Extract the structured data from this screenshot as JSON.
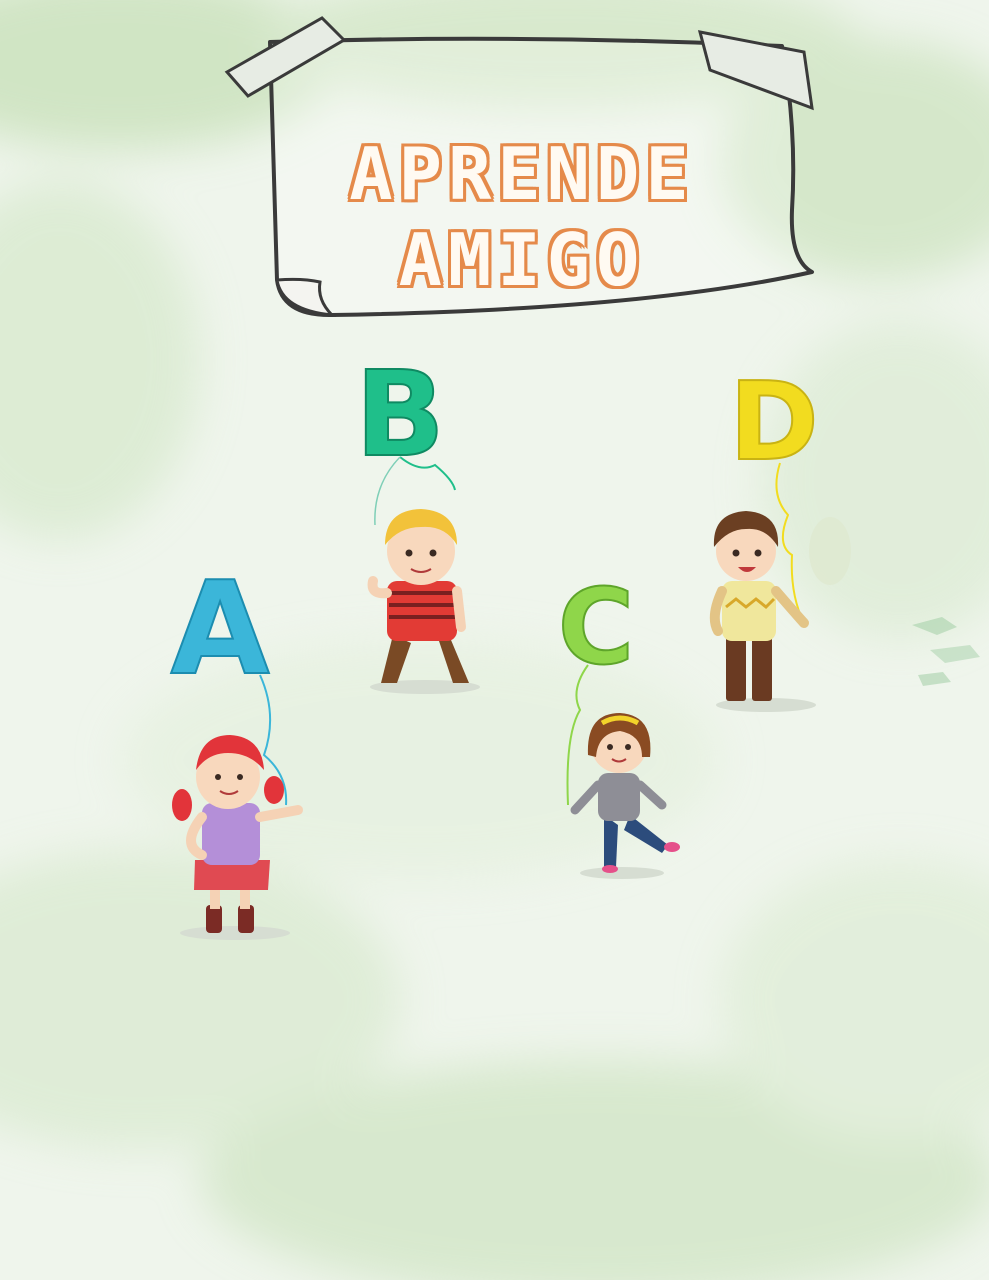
{
  "title": {
    "line1": "APRENDE",
    "line2": "AMIGO"
  },
  "balloons": [
    {
      "letter": "A",
      "color": "#3bb6d9",
      "icon": "girl-red-hair"
    },
    {
      "letter": "B",
      "color": "#1fbf8a",
      "icon": "boy-blond-hair"
    },
    {
      "letter": "C",
      "color": "#8fd64a",
      "icon": "girl-brown-hair"
    },
    {
      "letter": "D",
      "color": "#f2dc1f",
      "icon": "boy-brown-hair"
    }
  ],
  "colors": {
    "background": "#eef4ea",
    "title_fill": "#fffaf2",
    "title_outline": "#e58a4a"
  }
}
